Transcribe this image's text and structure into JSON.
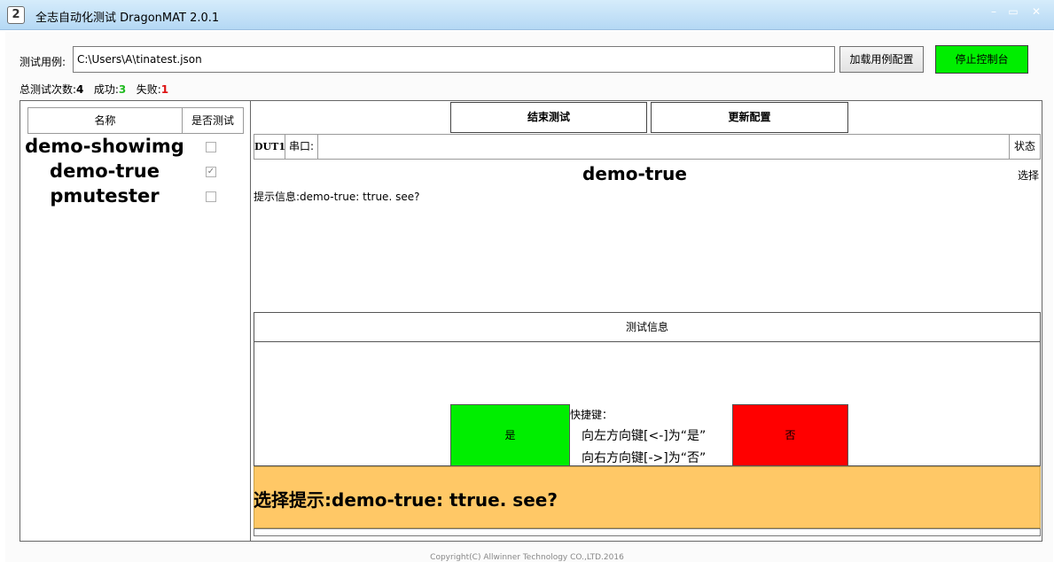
{
  "window": {
    "title": "全志自动化测试 DragonMAT 2.0.1",
    "app_icon": "2",
    "minimize": "–",
    "maximize": "▭",
    "close": "✕"
  },
  "top": {
    "case_label": "测试用例:",
    "case_path": "C:\\Users\\A\\tinatest.json",
    "load_button": "加载用例配置",
    "stop_button": "停止控制台"
  },
  "stats": {
    "total_label": "总测试次数:",
    "total_value": "4",
    "success_label": "成功:",
    "success_value": "3",
    "fail_label": "失败:",
    "fail_value": "1"
  },
  "case_list": {
    "col_name": "名称",
    "col_check": "是否测试",
    "items": [
      {
        "name": "demo-showimg",
        "checked": false
      },
      {
        "name": "demo-true",
        "checked": true
      },
      {
        "name": "pmutester",
        "checked": false
      }
    ]
  },
  "toolbar": {
    "end_button": "结束测试",
    "update_button": "更新配置"
  },
  "dut": {
    "dut_label": "DUT1",
    "port_label": "串口:",
    "status_label": "状态"
  },
  "main": {
    "case_title": "demo-true",
    "select_label": "选择",
    "hint_text": "提示信息:demo-true: ttrue. see?"
  },
  "test_info": {
    "header": "测试信息",
    "yes_button": "是",
    "no_button": "否",
    "shortcut_title": "快捷键：",
    "shortcut_left": "向左方向键[<-]为“是”",
    "shortcut_right": "向右方向键[->]为“否”"
  },
  "prompt": {
    "text": "选择提示:demo-true: ttrue. see?"
  },
  "footer": {
    "copyright": "Copyright(C) Allwinner Technology CO.,LTD.2016"
  },
  "colors": {
    "stop_button": "#00ee00",
    "yes_button": "#00ee00",
    "no_button": "#ff0000",
    "prompt_bar": "#ffc866",
    "success_text": "#22bb22",
    "fail_text": "#dd1111"
  }
}
